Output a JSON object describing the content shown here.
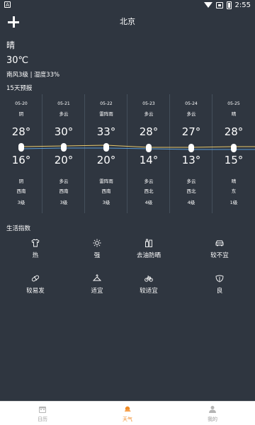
{
  "status_bar": {
    "time": "2:55",
    "left_glyph": "A"
  },
  "header": {
    "city": "北京",
    "add_icon": "plus-icon"
  },
  "current": {
    "condition": "晴",
    "temperature": "30℃",
    "details": "南风3级 | 湿度33%"
  },
  "forecast_title": "15天预报",
  "forecast": [
    {
      "date": "05-20",
      "day_weather": "阴",
      "high": "28°",
      "low": "16°",
      "night_weather": "阴",
      "wind_dir": "西南",
      "wind_level": "3级"
    },
    {
      "date": "05-21",
      "day_weather": "多云",
      "high": "30°",
      "low": "20°",
      "night_weather": "多云",
      "wind_dir": "西南",
      "wind_level": "3级"
    },
    {
      "date": "05-22",
      "day_weather": "雷阵雨",
      "high": "33°",
      "low": "20°",
      "night_weather": "雷阵雨",
      "wind_dir": "西南",
      "wind_level": "3级"
    },
    {
      "date": "05-23",
      "day_weather": "多云",
      "high": "28°",
      "low": "14°",
      "night_weather": "多云",
      "wind_dir": "西北",
      "wind_level": "4级"
    },
    {
      "date": "05-24",
      "day_weather": "多云",
      "high": "27°",
      "low": "13°",
      "night_weather": "多云",
      "wind_dir": "西北",
      "wind_level": "4级"
    },
    {
      "date": "05-25",
      "day_weather": "晴",
      "high": "28°",
      "low": "15°",
      "night_weather": "晴",
      "wind_dir": "东",
      "wind_level": "1级"
    }
  ],
  "life_title": "生活指数",
  "life_index": [
    {
      "label": "热",
      "icon": "shirt-icon"
    },
    {
      "label": "强",
      "icon": "sun-icon"
    },
    {
      "label": "去油防晒",
      "icon": "sunscreen-icon"
    },
    {
      "label": "较不宜",
      "icon": "car-icon"
    },
    {
      "label": "较易发",
      "icon": "pill-icon"
    },
    {
      "label": "适宜",
      "icon": "hanger-icon"
    },
    {
      "label": "较适宜",
      "icon": "bicycle-icon"
    },
    {
      "label": "良",
      "icon": "leaf-icon"
    }
  ],
  "tabs": [
    {
      "label": "日历",
      "icon": "calendar-icon",
      "active": false
    },
    {
      "label": "天气",
      "icon": "weather-icon",
      "active": true
    },
    {
      "label": "我的",
      "icon": "user-icon",
      "active": false
    }
  ],
  "colors": {
    "background": "#2f3640",
    "day_line": "#e8c86a",
    "night_line": "#5b9bd5",
    "tab_active": "#f08a24",
    "tab_inactive": "#9a9a9a"
  }
}
